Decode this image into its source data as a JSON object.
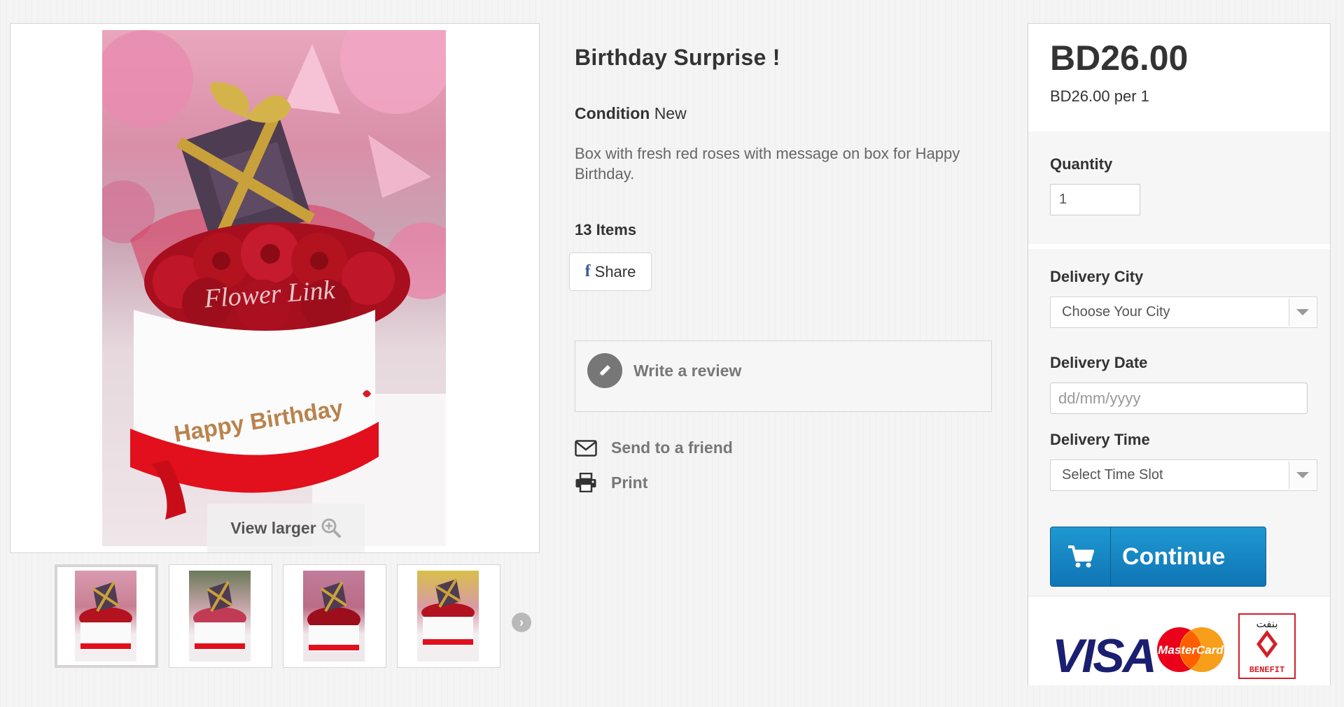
{
  "gallery": {
    "photo_text": "Happy Birthday",
    "watermark": "Flower Link",
    "view_larger_label": "View larger",
    "thumbnails": [
      "thumb-1",
      "thumb-2",
      "thumb-3",
      "thumb-4"
    ]
  },
  "product": {
    "title": "Birthday Surprise !",
    "condition_label": "Condition",
    "condition_value": "New",
    "description": "Box with fresh red roses with message on box for Happy Birthday.",
    "items_count": "13 Items",
    "share_label": "Share",
    "write_review_label": "Write a review",
    "send_friend_label": "Send to a friend",
    "print_label": "Print"
  },
  "buy_box": {
    "price": "BD26.00",
    "price_per": "BD26.00 per 1",
    "quantity_label": "Quantity",
    "quantity_value": "1",
    "delivery_city_label": "Delivery City",
    "delivery_city_value": "Choose Your City",
    "delivery_date_label": "Delivery Date",
    "delivery_date_placeholder": "dd/mm/yyyy",
    "delivery_time_label": "Delivery Time",
    "delivery_time_value": "Select Time Slot",
    "continue_label": "Continue",
    "payment_logos": {
      "visa": "VISA",
      "mastercard": "MasterCard",
      "benefit": "BENEFIT",
      "benefit_arabic": "بنفت"
    }
  },
  "colors": {
    "accent_blue": "#1587c4",
    "mastercard_red": "#eb001b",
    "mastercard_orange": "#f79e1b",
    "visa_blue": "#1a1f71",
    "benefit_red": "#d32028"
  }
}
